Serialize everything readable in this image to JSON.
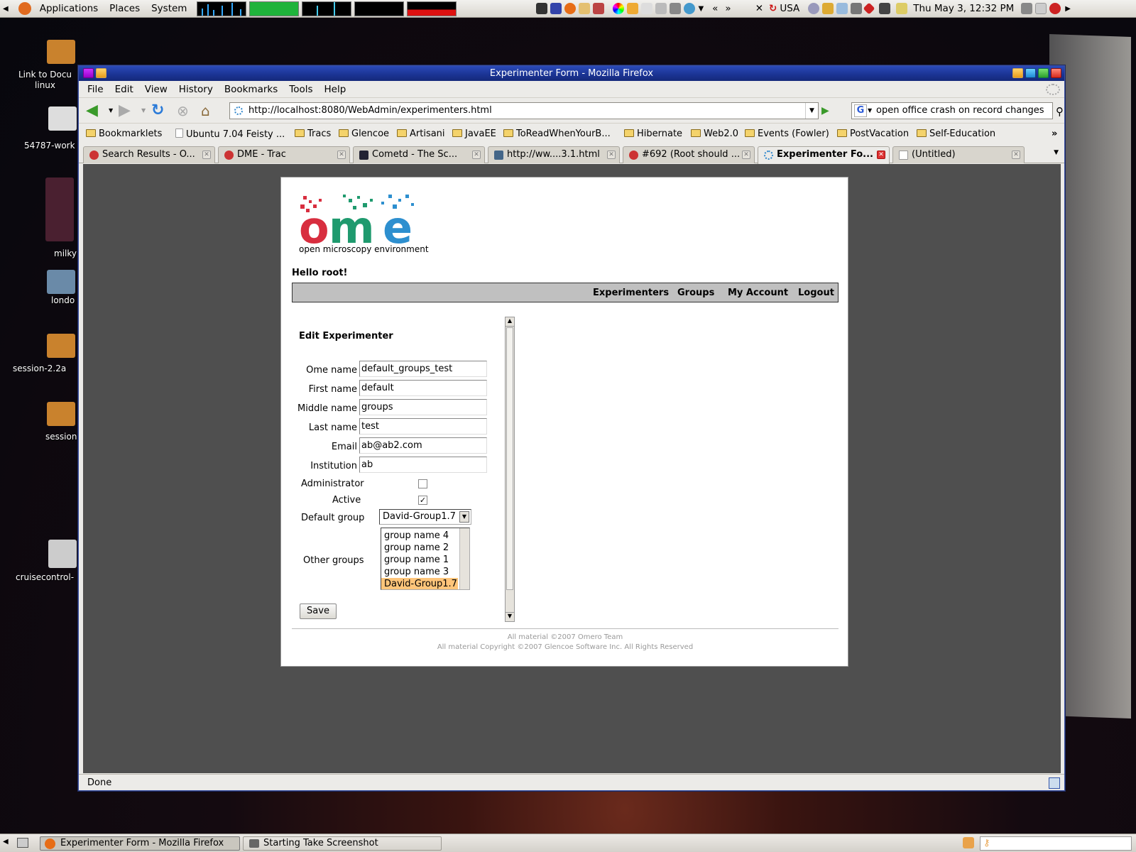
{
  "top_panel": {
    "menus": [
      "Applications",
      "Places",
      "System"
    ],
    "keyboard_layout": "USA",
    "clock": "Thu May  3, 12:32 PM"
  },
  "desktop": {
    "icons": [
      {
        "label": "Link to Docu\nlinux"
      },
      {
        "label": "54787-work"
      },
      {
        "label": "milky"
      },
      {
        "label": "londo"
      },
      {
        "label": "session-2.2a"
      },
      {
        "label": "session"
      },
      {
        "label": "cruisecontrol-"
      }
    ]
  },
  "window": {
    "title": "Experimenter Form - Mozilla Firefox",
    "menu": [
      "File",
      "Edit",
      "View",
      "History",
      "Bookmarks",
      "Tools",
      "Help"
    ],
    "url": "http://localhost:8080/WebAdmin/experimenters.html",
    "search_text": "open office crash on record changes",
    "bookmarks": [
      "Bookmarklets",
      "Ubuntu 7.04 Feisty ...",
      "Tracs",
      "Glencoe",
      "Artisani",
      "JavaEE",
      "ToReadWhenYourB...",
      "Hibernate",
      "Web2.0",
      "Events (Fowler)",
      "PostVacation",
      "Self-Education"
    ],
    "tabs": [
      {
        "label": "Search Results - O...",
        "active": false
      },
      {
        "label": "DME - Trac",
        "active": false
      },
      {
        "label": "Cometd - The Sc...",
        "active": false
      },
      {
        "label": "http://ww....3.1.html",
        "active": false
      },
      {
        "label": "#692 (Root should ...",
        "active": false
      },
      {
        "label": "Experimenter Fo...",
        "active": true
      },
      {
        "label": "(Untitled)",
        "active": false
      }
    ],
    "status": "Done"
  },
  "page": {
    "logo_text": "open microscopy environment",
    "greeting": "Hello root!",
    "nav": [
      "Experimenters",
      "Groups",
      "My Account",
      "Logout"
    ],
    "form_title": "Edit Experimenter",
    "fields": {
      "ome_name": {
        "label": "Ome name",
        "value": "default_groups_test"
      },
      "first_name": {
        "label": "First name",
        "value": "default"
      },
      "middle_name": {
        "label": "Middle name",
        "value": "groups"
      },
      "last_name": {
        "label": "Last name",
        "value": "test"
      },
      "email": {
        "label": "Email",
        "value": "ab@ab2.com"
      },
      "institution": {
        "label": "Institution",
        "value": "ab"
      }
    },
    "administrator": {
      "label": "Administrator",
      "checked": false
    },
    "active": {
      "label": "Active",
      "checked": true
    },
    "default_group": {
      "label": "Default group",
      "value": "David-Group1.7"
    },
    "other_groups": {
      "label": "Other groups",
      "options": [
        "group name 4",
        "group name 2",
        "group name 1",
        "group name 3",
        "David-Group1.7"
      ],
      "selected": "David-Group1.7"
    },
    "save_label": "Save",
    "footer_line1": "All material ©2007 Omero Team",
    "footer_line2": "All material Copyright ©2007 Glencoe Software Inc. All Rights Reserved"
  },
  "taskbar": {
    "items": [
      "Experimenter Form - Mozilla Firefox",
      "Starting Take Screenshot"
    ]
  },
  "colors": {
    "title_bar": "#1f3a9e",
    "logo_red": "#d82e3f",
    "logo_green": "#1f9a6e",
    "logo_blue": "#2d8fcf",
    "selection": "#ffc57a"
  }
}
